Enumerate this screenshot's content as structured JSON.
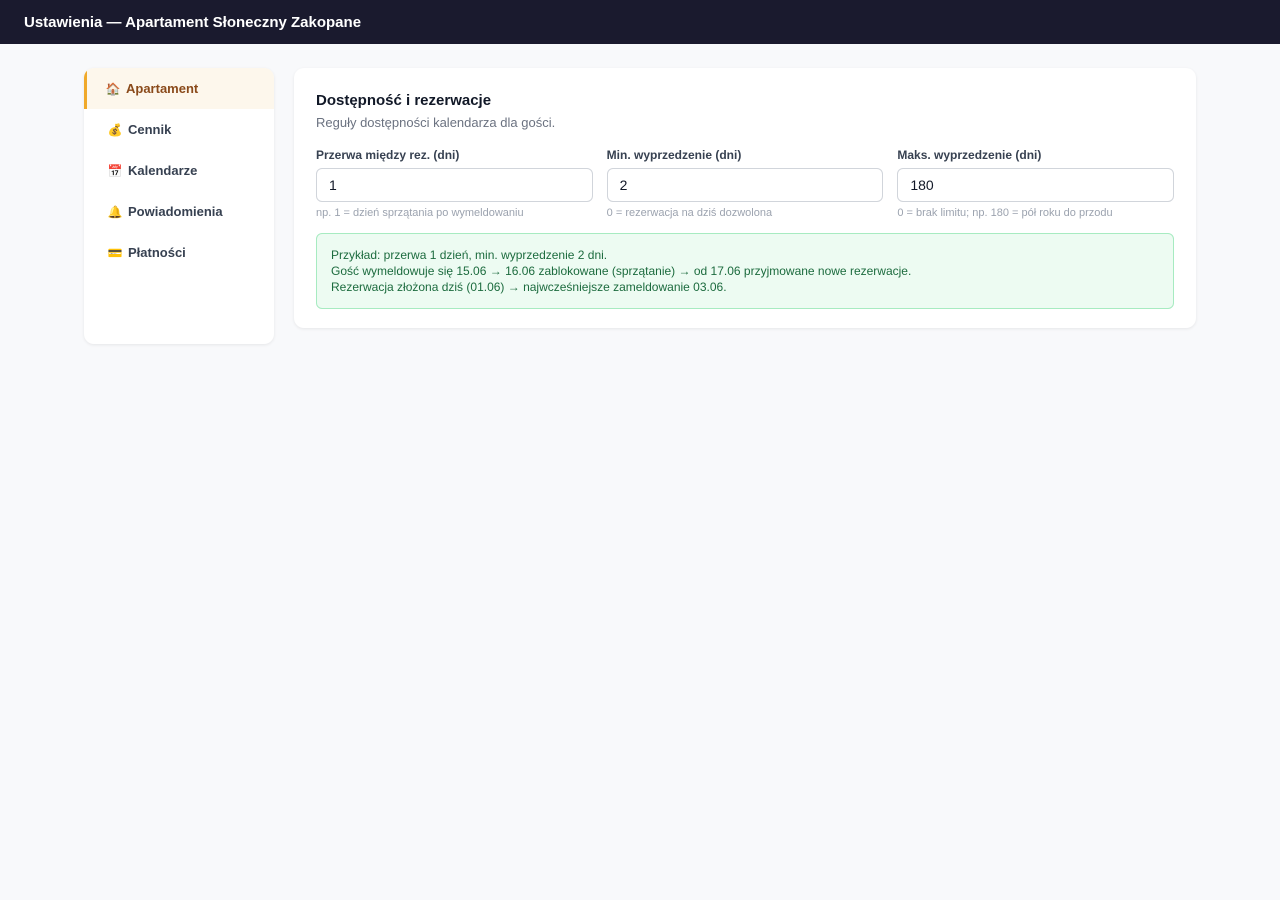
{
  "header": {
    "title": "Ustawienia — Apartament Słoneczny Zakopane"
  },
  "sidebar": {
    "items": [
      {
        "icon": "house-icon",
        "glyph": "🏠",
        "label": "Apartament",
        "active": true
      },
      {
        "icon": "money-bag-icon",
        "glyph": "💰",
        "label": "Cennik",
        "active": false
      },
      {
        "icon": "calendar-icon",
        "glyph": "📅",
        "label": "Kalendarze",
        "active": false
      },
      {
        "icon": "bell-icon",
        "glyph": "🔔",
        "label": "Powiadomienia",
        "active": false
      },
      {
        "icon": "credit-card-icon",
        "glyph": "💳",
        "label": "Płatności",
        "active": false
      }
    ]
  },
  "section": {
    "title": "Dostępność i rezerwacje",
    "subtitle": "Reguły dostępności kalendarza dla gości.",
    "fields": [
      {
        "label": "Przerwa między rez. (dni)",
        "value": "1",
        "hint": "np. 1 = dzień sprzątania po wymeldowaniu"
      },
      {
        "label": "Min. wyprzedzenie (dni)",
        "value": "2",
        "hint": "0 = rezerwacja na dziś dozwolona"
      },
      {
        "label": "Maks. wyprzedzenie (dni)",
        "value": "180",
        "hint": "0 = brak limitu; np. 180 = pół roku do przodu"
      }
    ],
    "example_lines": [
      "Przykład: przerwa 1 dzień, min. wyprzedzenie 2 dni.",
      "Gość wymeldowuje się 15.06 → 16.06 zablokowane (sprzątanie) → od 17.06 przyjmowane nowe rezerwacje.",
      "Rezerwacja złożona dziś (01.06) → najwcześniejsze zameldowanie 03.06."
    ]
  },
  "colors": {
    "topbar": "#1a1a2e",
    "accent": "#f0a92a",
    "success_bg": "#edfbf2",
    "success_text": "#1c6b3e"
  }
}
